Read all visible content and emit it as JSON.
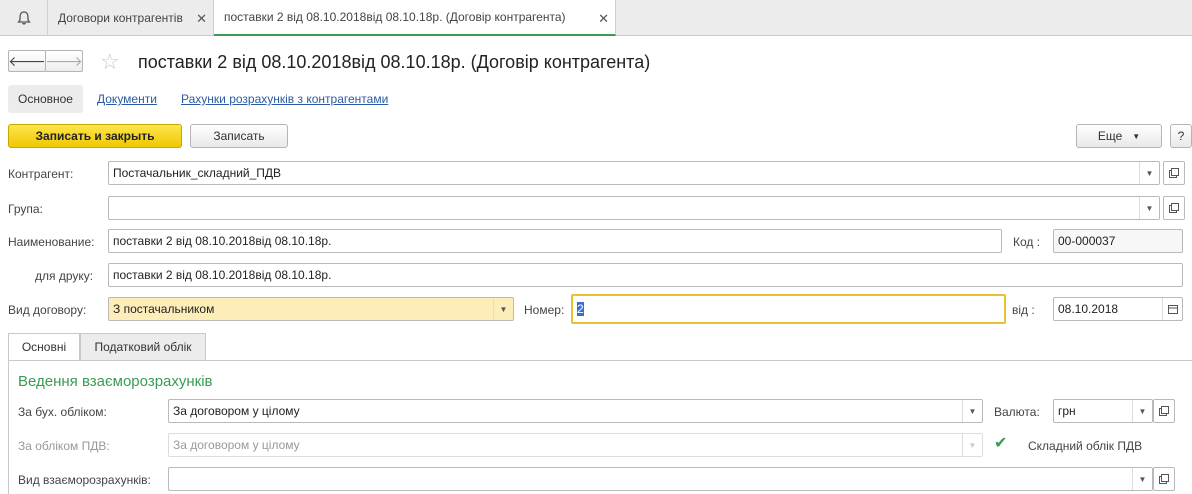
{
  "tabs": [
    {
      "label": "Договори контрагентів"
    },
    {
      "label": "поставки 2 від 08.10.2018від 08.10.18р. (Договір контрагента)"
    }
  ],
  "header": {
    "title": "поставки 2 від 08.10.2018від 08.10.18р. (Договір контрагента)"
  },
  "sections": {
    "main": "Основное",
    "documents": "Документи",
    "accounts": "Рахунки розрахунків з контрагентами"
  },
  "toolbar": {
    "save_close": "Записать и закрыть",
    "save": "Записать",
    "more": "Еще",
    "help": "?"
  },
  "form": {
    "counterparty": {
      "label": "Контрагент:",
      "value": "Постачальник_складний_ПДВ"
    },
    "group": {
      "label": "Група:",
      "value": ""
    },
    "name": {
      "label": "Наименование:",
      "value": "поставки 2 від 08.10.2018від 08.10.18р."
    },
    "code": {
      "label": "Код",
      "value": "00-000037"
    },
    "print_name": {
      "label": "для друку:",
      "value": "поставки 2 від 08.10.2018від 08.10.18р."
    },
    "contract_type": {
      "label": "Вид договору:",
      "value": "З постачальником"
    },
    "number": {
      "label": "Номер:",
      "value": "2"
    },
    "date": {
      "label": "від",
      "value": "08.10.2018"
    }
  },
  "form_tabs": [
    {
      "label": "Основні"
    },
    {
      "label": "Податковий облік"
    }
  ],
  "settlements": {
    "title": "Ведення взаєморозрахунків",
    "accounting": {
      "label": "За бух. обліком:",
      "value": "За договором у цілому"
    },
    "currency": {
      "label": "Валюта:",
      "value": "грн"
    },
    "vat": {
      "label": "За обліком ПДВ:",
      "value": "За договором у цілому"
    },
    "complex_vat": {
      "label": "Складний облік ПДВ",
      "checked": true
    },
    "settlement_type": {
      "label": "Вид взаєморозрахунків:",
      "value": ""
    }
  },
  "colors": {
    "accent": "#3a9b54",
    "primary_button": "#f0c800",
    "link": "#2a5aa5"
  }
}
